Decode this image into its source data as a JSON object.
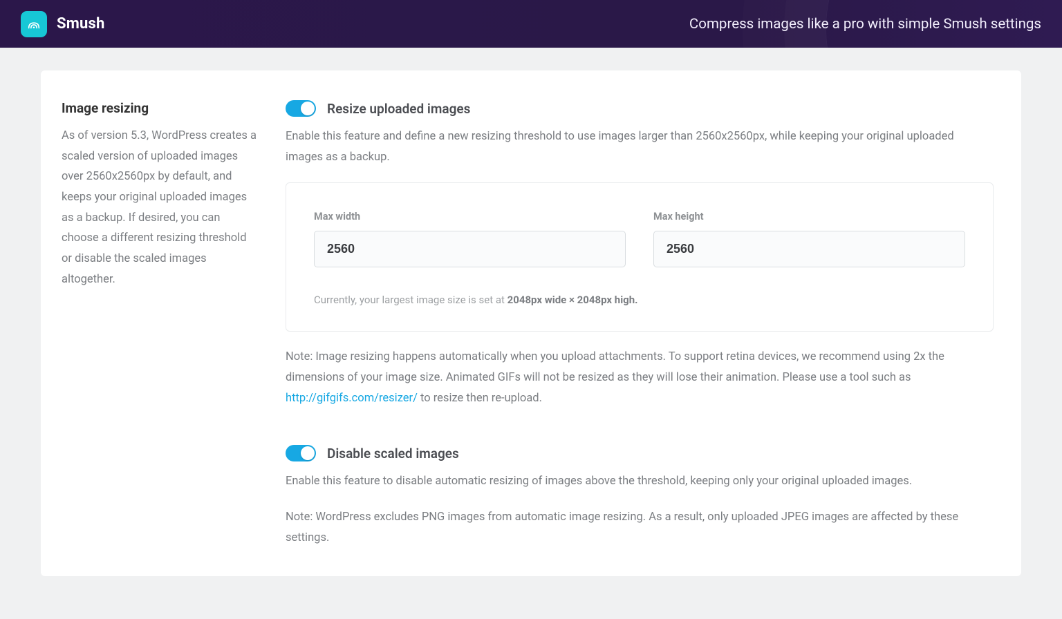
{
  "header": {
    "app_name": "Smush",
    "tagline": "Compress images like a pro with simple Smush settings"
  },
  "section": {
    "title": "Image resizing",
    "description": "As of version 5.3, WordPress creates a scaled version of uploaded images over 2560x2560px by default, and keeps your original uploaded images as a backup. If desired, you can choose a different resizing threshold or disable the scaled images altogether."
  },
  "resize": {
    "title": "Resize uploaded images",
    "description": "Enable this feature and define a new resizing threshold to use images larger than 2560x2560px, while keeping your original uploaded images as a backup.",
    "max_width_label": "Max width",
    "max_width_value": "2560",
    "max_height_label": "Max height",
    "max_height_value": "2560",
    "current_note_prefix": "Currently, your largest image size is set at ",
    "current_note_strong": "2048px wide × 2048px high.",
    "note_before_link": "Note: Image resizing happens automatically when you upload attachments. To support retina devices, we recommend using 2x the dimensions of your image size. Animated GIFs will not be resized as they will lose their animation. Please use a tool such as ",
    "link_text": "http://gifgifs.com/resizer/",
    "note_after_link": " to resize then re-upload."
  },
  "disable": {
    "title": "Disable scaled images",
    "description": "Enable this feature to disable automatic resizing of images above the threshold, keeping only your original uploaded images.",
    "note": "Note: WordPress excludes PNG images from automatic image resizing. As a result, only uploaded JPEG images are affected by these settings."
  }
}
